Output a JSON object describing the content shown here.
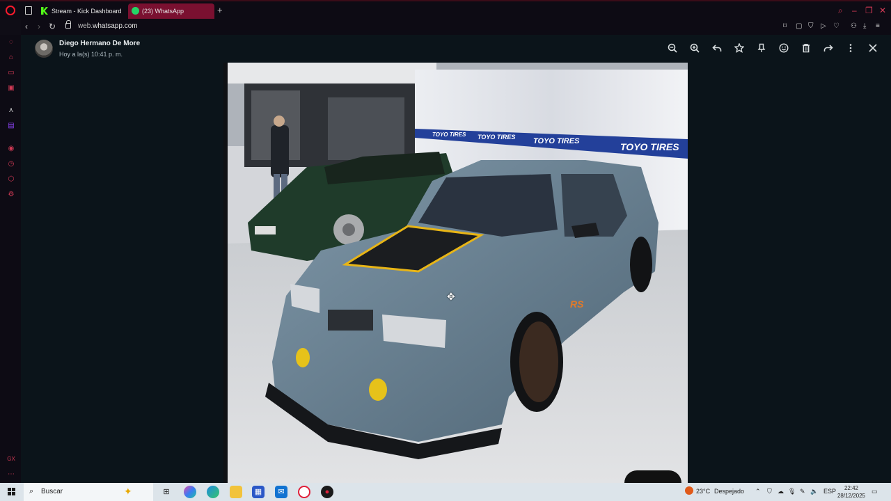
{
  "browser": {
    "tabs": [
      {
        "label": "Stream - Kick Dashboard",
        "active": false
      },
      {
        "label": "(23) WhatsApp",
        "active": true
      }
    ],
    "new_tab": "+",
    "url_domain": "web.",
    "url_rest": "whatsapp.com",
    "accent_color": "#d23a55"
  },
  "viewer": {
    "sender_name": "Diego Hermano De More",
    "sent_time": "Hoy a la(s) 10:41 p. m.",
    "header_icons": [
      "zoom-out-icon",
      "zoom-in-icon",
      "reply-icon",
      "star-icon",
      "pin-icon",
      "emoji-icon",
      "delete-icon",
      "forward-icon",
      "more-icon",
      "close-icon"
    ],
    "photo_banner_text": [
      "TOYO TIRES",
      "TOYO TIRES",
      "TOYO TIRES",
      "TOYO TIRES"
    ],
    "car_badge": "RS"
  },
  "taskbar": {
    "search_label": "Buscar",
    "weather_temp": "23°C",
    "weather_desc": "Despejado",
    "language": "ESP",
    "time": "22:42",
    "date": "28/12/2025"
  }
}
